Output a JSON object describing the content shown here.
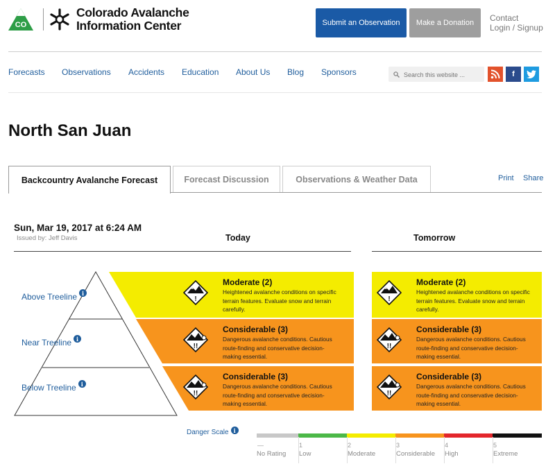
{
  "header": {
    "logo_badge": "CO",
    "org_line1": "Colorado Avalanche",
    "org_line2": "Information Center",
    "submit_label": "Submit an Observation",
    "donate_label": "Make a Donation",
    "contact_label": "Contact",
    "login_label": "Login",
    "login_sep": "/",
    "signup_label": "Signup",
    "colors": {
      "primary_button": "#1a5aa6",
      "secondary_button": "#9e9e9e",
      "link": "#1f5d9c"
    }
  },
  "nav": {
    "items": [
      {
        "label": "Forecasts"
      },
      {
        "label": "Observations"
      },
      {
        "label": "Accidents"
      },
      {
        "label": "Education"
      },
      {
        "label": "About Us"
      },
      {
        "label": "Blog"
      },
      {
        "label": "Sponsors"
      }
    ],
    "search_placeholder": "Search this website ...",
    "social": {
      "rss": "rss-icon",
      "facebook_label": "f",
      "twitter": "twitter-icon"
    }
  },
  "page": {
    "title": "North San Juan",
    "tabs": [
      {
        "label": "Backcountry Avalanche Forecast",
        "active": true
      },
      {
        "label": "Forecast Discussion",
        "active": false
      },
      {
        "label": "Observations & Weather Data",
        "active": false
      }
    ],
    "print_label": "Print",
    "share_label": "Share"
  },
  "forecast": {
    "date": "Sun, Mar 19, 2017 at 6:24 AM",
    "issued_by": "Issued by: Jeff Davis",
    "today_label": "Today",
    "tomorrow_label": "Tomorrow",
    "zones": [
      {
        "label": "Above Treeline"
      },
      {
        "label": "Near Treeline"
      },
      {
        "label": "Below Treeline"
      }
    ],
    "today": [
      {
        "rating": "Moderate (2)",
        "level": 2,
        "color": "#f4ec00",
        "desc": [
          "Heightened avalanche conditions on specific",
          "terrain features. Evaluate snow and terrain",
          "carefully."
        ]
      },
      {
        "rating": "Considerable (3)",
        "level": 3,
        "color": "#f7941d",
        "desc": [
          "Dangerous avalanche conditions. Cautious",
          "route-finding and conservative decision-",
          "making essential."
        ]
      },
      {
        "rating": "Considerable (3)",
        "level": 3,
        "color": "#f7941d",
        "desc": [
          "Dangerous avalanche conditions. Cautious",
          "route-finding and conservative decision-",
          "making essential."
        ]
      }
    ],
    "tomorrow": [
      {
        "rating": "Moderate (2)",
        "level": 2,
        "color": "#f4ec00",
        "desc": [
          "Heightened avalanche conditions on specific",
          "terrain features. Evaluate snow and terrain",
          "carefully."
        ]
      },
      {
        "rating": "Considerable (3)",
        "level": 3,
        "color": "#f7941d",
        "desc": [
          "Dangerous avalanche conditions. Cautious",
          "route-finding and conservative decision-",
          "making essential."
        ]
      },
      {
        "rating": "Considerable (3)",
        "level": 3,
        "color": "#f7941d",
        "desc": [
          "Dangerous avalanche conditions. Cautious",
          "route-finding and conservative decision-",
          "making essential."
        ]
      }
    ]
  },
  "danger_scale": {
    "label": "Danger Scale",
    "levels": [
      {
        "num": "—",
        "name": "No Rating",
        "color": "#c8c8c8"
      },
      {
        "num": "1",
        "name": "Low",
        "color": "#4cb848"
      },
      {
        "num": "2",
        "name": "Moderate",
        "color": "#f4ec00"
      },
      {
        "num": "3",
        "name": "Considerable",
        "color": "#f7941d"
      },
      {
        "num": "4",
        "name": "High",
        "color": "#e3262b"
      },
      {
        "num": "5",
        "name": "Extreme",
        "color": "#111111"
      }
    ]
  }
}
